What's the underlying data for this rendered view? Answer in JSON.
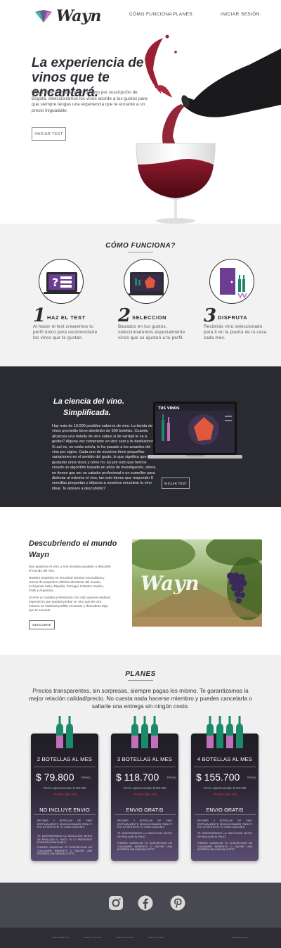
{
  "brand": {
    "name": "Wayn"
  },
  "nav": {
    "links": [
      "CÓMO FUNCIONA",
      "PLANES",
      "INICIAR SESIÓN"
    ]
  },
  "hero": {
    "title": "La experiencia de vinos que te encantará.",
    "text": "Wayn es el primer servicio de vino por suscripción de Bogotá, seleccionamos los vinos acorde a tus gustos para que siempre tengas una experiencia que te encante a un precio inigualable.",
    "button": "INICIAR TEST"
  },
  "como": {
    "title": "CÓMO FUNCIONA?",
    "steps": [
      {
        "num": "1",
        "name": "HAZ EL TEST",
        "desc": "Al hacer el test crearemos tu perfil único para recomendarte los vinos que te gustan."
      },
      {
        "num": "2",
        "name": "SELECCION",
        "desc": "Basados en tus gustos, seleccionaremos especialmente vinos que se ajusten a tu perfil."
      },
      {
        "num": "3",
        "name": "DISFRUTA",
        "desc": "Recibirás vino seleccionado para ti en la puerta de tu casa cada mes."
      }
    ]
  },
  "ciencia": {
    "title_line1": "La ciencia del vino.",
    "title_line2": "Simplificada.",
    "text": "Hay más de 10.000 posibles sabores de vino. La tienda de vinos promedio tiene alrededor de 500 botellas. Cuando alcanzas una botella de vino sabes si de verdad te va a gustar? Alguna vez compraste un vino caro y te desilusionó? Si así es, no estás solo/a, le ha pasado a los amantes del vino por siglos. Cada uno de nosotros tiene pequeñas variaciones en el sentido del gusto, lo que significa que nos gustarán unos vinos y otros no. Es por esto que hemos creado un algoritmo basado en años de investigación, ahora no tienes que ser un catador profesional o un sumellier para disfrutar al máximo el vino, tan solo tienes que responder 8 sencillas preguntas y déjanos a nosotros encontrar tu vino ideal. Te atreves a descubrirlo?",
    "button": "INICIAR TEST",
    "screen_title": "TUS VINOS"
  },
  "descubriendo": {
    "title": "Descubriendo el mundo Wayn",
    "p1": "Nos apasiona el vino, y nos encanta ayudarte a descubrir el mundo del vino.",
    "p2": "Nuestro propósito es encontrar tesoros escondidos y únicos de pequeños viñedos alrededor del mundo, incluyendo Italia, España, Portugal, Estados Unidos, Chile y Argentina.",
    "p3": "Si eres un catador profesional o sin solo quieres explorar, esperamos que puedas probar un vino que de otra manera no hubieras podido encontrar y descubras algo que te encante.",
    "button": "DESCUBRE",
    "image_text": "Wayn"
  },
  "planes": {
    "title": "PLANES",
    "subtitle": "Precios transparentes, sin sorpresas, siempre pagas los mismo. Te garantizamos la mejor relación calidad/precio.  No cuesta nada hacerse miembro y puedes cancelarla o saltarte una entrega sin ningún costo.",
    "cards": [
      {
        "name": "2 BOTELLAS AL MES",
        "price": "$ 79.800",
        "iva": "IVA inc.",
        "super": "Precio supermercado: $ 104.000",
        "ahorra": "Ahorras: $24.200",
        "envio": "NO INCLUYE ENVIO",
        "t1": "RECIBES 2 BOTELLAS DE VINO ESPECIALMENTE SELECCIONADAS PARA TI EN LA PUERTA DE TU CASA CADA MES",
        "t2": "TE MOSTRAREMOS LA SELECCION ANTES DE REALIZAR EL PAGO, SI LO PREFIERES PODRAS MODIFICARLA",
        "t3": "PUEDES CANCELAR TU SUSCRIPCION EN CUALQUIER MOMENTO O SALTAR UNA ENTREGA SIN NINGUN COSTO",
        "bottles": 2
      },
      {
        "name": "3 BOTELLAS AL MES",
        "price": "$ 118.700",
        "iva": "IVA inc.",
        "super": "Precio supermercado: $ 104.000",
        "ahorra": "Ahorras: $24.200",
        "envio": "ENVIO GRATIS",
        "t1": "RECIBES 3 BOTELLAS DE VINO ESPECIALMENTE SELECCIONADAS PARA TI EN LA PUERTA DE TU CASA CADA MES",
        "t2": "TE MOSTRAREMOS LA SELECCION ANTES DE REALIZAR EL PAGO",
        "t3": "PUEDES CANCELAR TU SUSCRIPCION EN CUALQUIER MOMENTO O SALTAR UNA ENTREGA SIN NINGUN COSTO",
        "bottles": 3
      },
      {
        "name": "4 BOTELLAS AL MES",
        "price": "$ 155.700",
        "iva": "IVA inc.",
        "super": "Precio supermercado: $ 104.000",
        "ahorra": "Ahorras: $24.200",
        "envio": "ENVIO GRATIS",
        "t1": "RECIBES 4 BOTELLAS DE VINO ESPECIALMENTE SELECCIONADAS PARA TI EN LA PUERTA DE TU CASA CADA MES",
        "t2": "TE MOSTRAREMOS LA SELECCION ANTES DE REALIZAR EL PAGO",
        "t3": "PUEDES CANCELAR TU SUSCRIPCION EN CUALQUIER MOMENTO O SALTAR UNA ENTREGA SIN NINGUN COSTO",
        "bottles": 4
      }
    ]
  },
  "social": {
    "icons": [
      "instagram-icon",
      "facebook-icon",
      "pinterest-icon"
    ]
  },
  "footer": {
    "links": [
      "© WAYN WINE S.A.S",
      "Términos y condiciones",
      "Política de privacidad",
      "Trabaja con nosotros",
      "contacto@wayn.com"
    ]
  },
  "colors": {
    "wine": "#7a1424",
    "dark": "#2a2a31",
    "purple": "#6c3d91",
    "green": "#1b8a6a",
    "pink": "#c070b8"
  }
}
